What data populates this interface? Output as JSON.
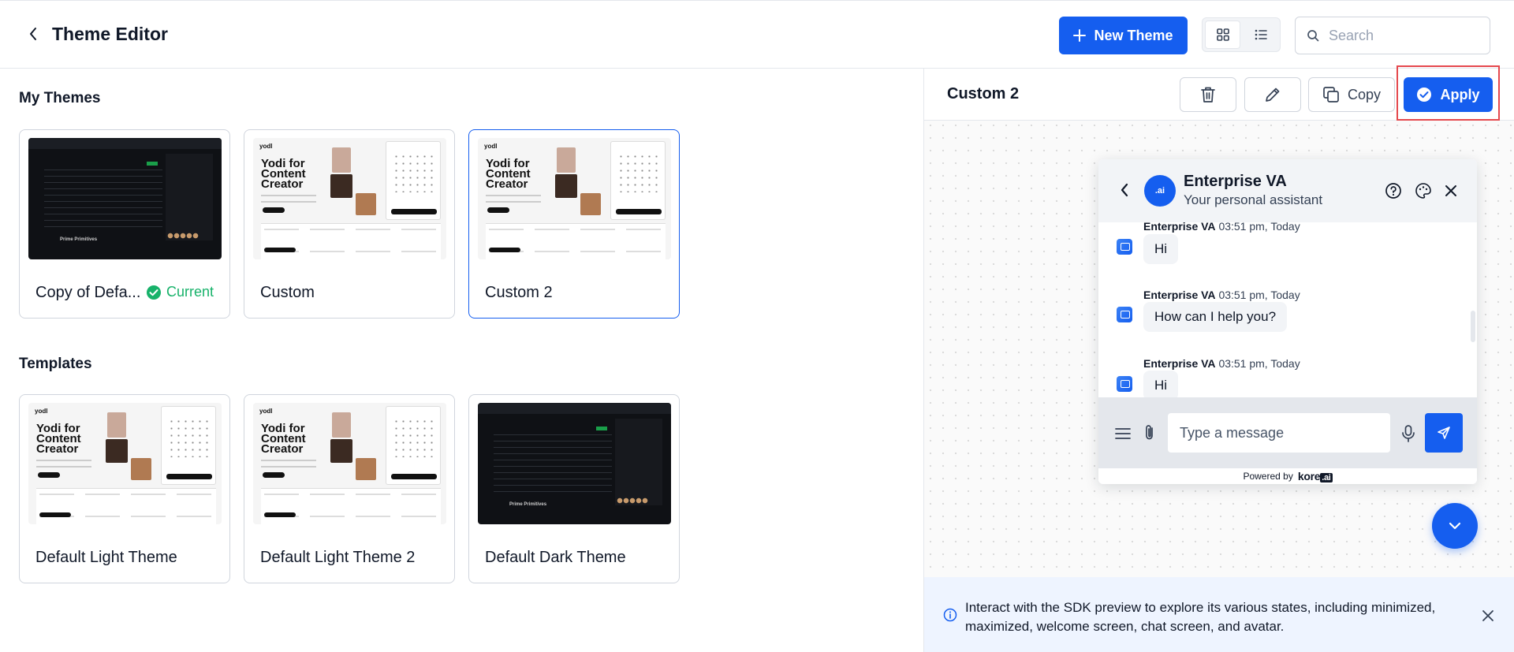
{
  "header": {
    "title": "Theme Editor",
    "new_theme_label": "New Theme",
    "search_placeholder": "Search",
    "view_mode": "grid"
  },
  "my_themes": {
    "title": "My Themes",
    "items": [
      {
        "name": "Copy of Defa...",
        "badge": "Current",
        "style": "dark"
      },
      {
        "name": "Custom",
        "style": "light"
      },
      {
        "name": "Custom 2",
        "style": "light",
        "selected": true
      }
    ]
  },
  "templates": {
    "title": "Templates",
    "items": [
      {
        "name": "Default Light Theme",
        "style": "light"
      },
      {
        "name": "Default Light Theme 2",
        "style": "light"
      },
      {
        "name": "Default Dark Theme",
        "style": "dark"
      }
    ]
  },
  "thumbnail": {
    "brand": "yodl",
    "hero": "Yodi for Content Creator",
    "dark_heading": "Prime Primitives"
  },
  "preview": {
    "title": "Custom 2",
    "copy_label": "Copy",
    "apply_label": "Apply",
    "chat": {
      "title": "Enterprise VA",
      "subtitle": "Your personal assistant",
      "avatar_text": ".ai",
      "messages": [
        {
          "sender": "Enterprise VA",
          "time": "03:51 pm, Today",
          "text": "Hi"
        },
        {
          "sender": "Enterprise VA",
          "time": "03:51 pm, Today",
          "text": "How can I help you?"
        },
        {
          "sender": "Enterprise VA",
          "time": "03:51 pm, Today",
          "text": "Hi"
        }
      ],
      "input_placeholder": "Type a message",
      "powered_by": "Powered by",
      "brand_name": "kore",
      "brand_suffix": ".ai"
    },
    "info_text": "Interact with the SDK preview to explore its various states, including minimized, maximized, welcome screen, chat screen, and avatar."
  },
  "colors": {
    "primary": "#155eef",
    "success": "#17b26a",
    "highlight": "#e5484d",
    "info_bg": "#eef4ff"
  }
}
